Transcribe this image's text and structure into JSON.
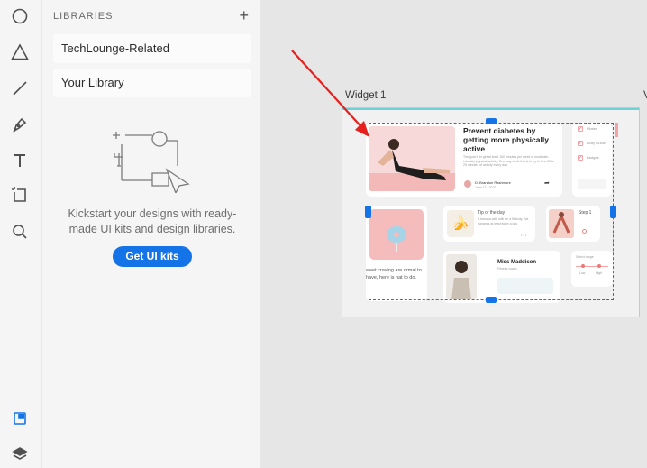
{
  "toolbar": {
    "tools": [
      {
        "name": "ellipse-tool",
        "icon": "ellipse-icon"
      },
      {
        "name": "polygon-tool",
        "icon": "triangle-icon"
      },
      {
        "name": "line-tool",
        "icon": "line-icon"
      },
      {
        "name": "pen-tool",
        "icon": "pen-icon"
      },
      {
        "name": "text-tool",
        "icon": "text-icon"
      },
      {
        "name": "artboard-tool",
        "icon": "artboard-icon"
      },
      {
        "name": "zoom-tool",
        "icon": "search-icon"
      }
    ],
    "bottom": [
      {
        "name": "libraries-tool",
        "icon": "libraries-icon",
        "active": true
      },
      {
        "name": "layers-tool",
        "icon": "layers-icon"
      }
    ]
  },
  "libraries": {
    "header": "LIBRARIES",
    "add_label": "+",
    "items": [
      {
        "label": "TechLounge-Related"
      },
      {
        "label": "Your Library"
      }
    ],
    "empty_text": "Kickstart your designs with ready-made UI kits and design libraries.",
    "cta_label": "Get UI kits"
  },
  "canvas": {
    "artboard_label": "Widget 1",
    "artboard_label_next": "V",
    "widget": {
      "headline": "Prevent diabetes by getting more physically active",
      "headline_body": "The goal is to get at least 150 minutes per week of moderate-intensity physical activity. One way to do this is to try to fit in 20 to 25 minutes of activity every day.",
      "author": "Dr.Brandon Rashmore",
      "author_meta": "June 17 · 2022",
      "checklist": [
        "Pilates",
        "Body Guide",
        "Badges"
      ],
      "tip_title": "Tip of the day",
      "tip_body": "A banana with milk for a fit body. Eat bananas at least twice a day",
      "step_title": "Step 1",
      "craving_text": "weet craving are ormal to have, here is hat to do.",
      "profile_name": "Miss Maddison",
      "profile_meta": "Fitness coach",
      "slider_caption": "Select range",
      "slider_min": "Low",
      "slider_max": "High"
    }
  },
  "colors": {
    "accent": "#1473e6",
    "selection": "#1473e6",
    "annotation_arrow": "#e5201e",
    "artboard_top": "#6fd0d6"
  }
}
